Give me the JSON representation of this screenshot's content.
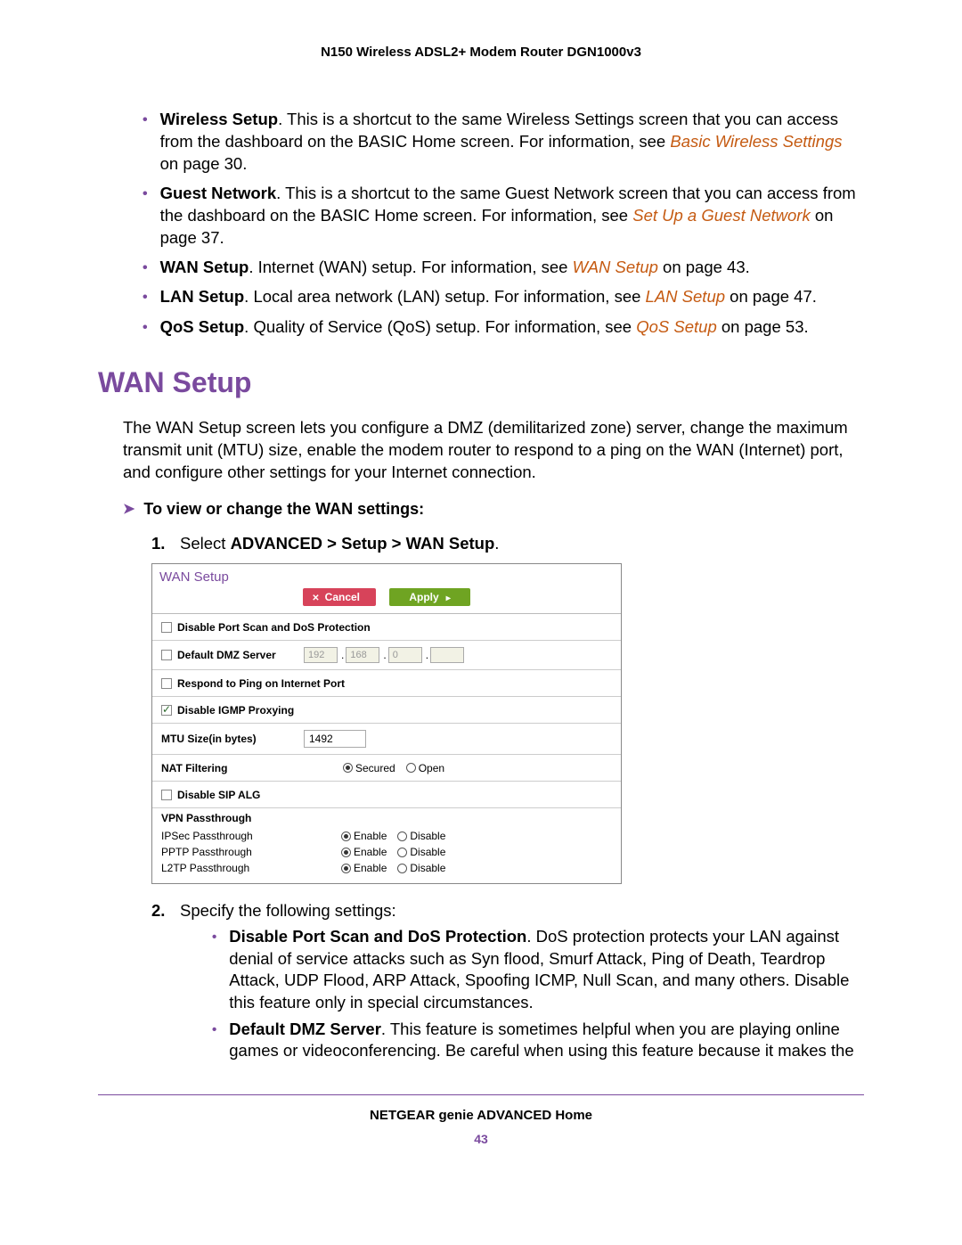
{
  "header": {
    "title": "N150 Wireless ADSL2+ Modem Router DGN1000v3"
  },
  "intro_bullets": [
    {
      "bold": "Wireless Setup",
      "text1": ". This is a shortcut to the same Wireless Settings screen that you can access from the dashboard on the BASIC Home screen. For information, see ",
      "link": "Basic Wireless Settings",
      "text2": " on page 30."
    },
    {
      "bold": "Guest Network",
      "text1": ". This is a shortcut to the same Guest Network screen that you can access from the dashboard on the BASIC Home screen. For information, see ",
      "link": "Set Up a Guest Network",
      "text2": " on page 37."
    },
    {
      "bold": "WAN Setup",
      "text1": ". Internet (WAN) setup. For information, see ",
      "link": "WAN Setup",
      "text2": " on page 43."
    },
    {
      "bold": "LAN Setup",
      "text1": ". Local area network (LAN) setup. For information, see ",
      "link": "LAN Setup",
      "text2": " on page 47."
    },
    {
      "bold": "QoS Setup",
      "text1": ". Quality of Service (QoS) setup. For information, see ",
      "link": "QoS Setup",
      "text2": " on page 53."
    }
  ],
  "section": {
    "heading": "WAN Setup",
    "intro": "The WAN Setup screen lets you configure a DMZ (demilitarized zone) server, change the maximum transmit unit (MTU) size, enable the modem router to respond to a ping on the WAN (Internet) port, and configure other settings for your Internet connection.",
    "step_heading": "To view or change the WAN settings:"
  },
  "steps": {
    "s1_num": "1.",
    "s1_pre": "Select ",
    "s1_bold": "ADVANCED > Setup > WAN Setup",
    "s1_post": ".",
    "s2_num": "2.",
    "s2_text": "Specify the following settings:"
  },
  "wan_form": {
    "title": "WAN Setup",
    "cancel": "Cancel",
    "apply": "Apply",
    "rows": {
      "disable_port_scan": "Disable Port Scan and DoS Protection",
      "default_dmz": "Default DMZ Server",
      "dmz_ip": [
        "192",
        "168",
        "0",
        ""
      ],
      "respond_ping": "Respond to Ping on Internet Port",
      "disable_igmp": "Disable IGMP Proxying",
      "mtu_label": "MTU Size(in bytes)",
      "mtu_value": "1492",
      "nat_label": "NAT Filtering",
      "nat_secured": "Secured",
      "nat_open": "Open",
      "disable_sip": "Disable SIP ALG",
      "vpn_title": "VPN Passthrough",
      "ipsec": "IPSec Passthrough",
      "pptp": "PPTP Passthrough",
      "l2tp": "L2TP Passthrough",
      "enable": "Enable",
      "disable": "Disable"
    }
  },
  "spec_bullets": [
    {
      "bold": "Disable Port Scan and DoS Protection",
      "text": ". DoS protection protects your LAN against denial of service attacks such as Syn flood, Smurf Attack, Ping of Death, Teardrop Attack, UDP Flood, ARP Attack, Spoofing ICMP, Null Scan, and many others. Disable this feature only in special circumstances."
    },
    {
      "bold": "Default DMZ Server",
      "text": ". This feature is sometimes helpful when you are playing online games or videoconferencing. Be careful when using this feature because it makes the"
    }
  ],
  "footer": {
    "text": "NETGEAR genie ADVANCED Home",
    "page": "43"
  }
}
